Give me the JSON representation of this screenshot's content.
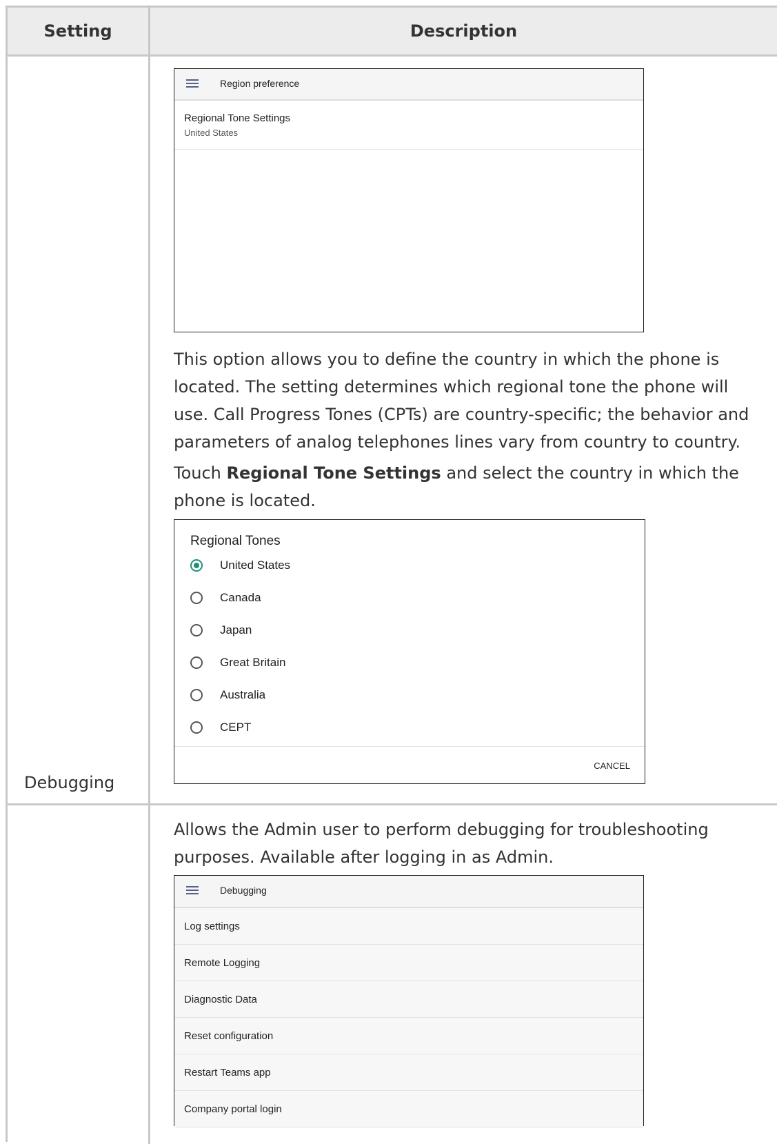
{
  "table": {
    "headers": {
      "setting": "Setting",
      "description": "Description"
    }
  },
  "region": {
    "screenshot": {
      "title": "Region preference",
      "item_title": "Regional Tone Settings",
      "item_value": "United States"
    },
    "para1": "This option allows you to define the country in which the phone is located. The setting determines which regional tone the phone will use. Call Progress Tones (CPTs) are country-specific; the behavior and parameters of analog telephones lines vary from country to country.",
    "para2_before": "Touch ",
    "para2_bold": "Regional Tone Settings",
    "para2_after": " and select the country in which the phone is located.",
    "dialog": {
      "title": "Regional Tones",
      "options": [
        "United States",
        "Canada",
        "Japan",
        "Great Britain",
        "Australia",
        "CEPT"
      ],
      "selected": "United States",
      "cancel": "CANCEL",
      "accent_color": "#1f8f7a"
    }
  },
  "debugging": {
    "setting": "Debugging",
    "para": "Allows the Admin user to perform debugging for troubleshooting purposes. Available after logging in as Admin.",
    "screenshot": {
      "title": "Debugging",
      "items": [
        "Log settings",
        "Remote Logging",
        "Diagnostic Data",
        "Reset configuration",
        "Restart Teams app",
        "Company portal login"
      ]
    }
  }
}
